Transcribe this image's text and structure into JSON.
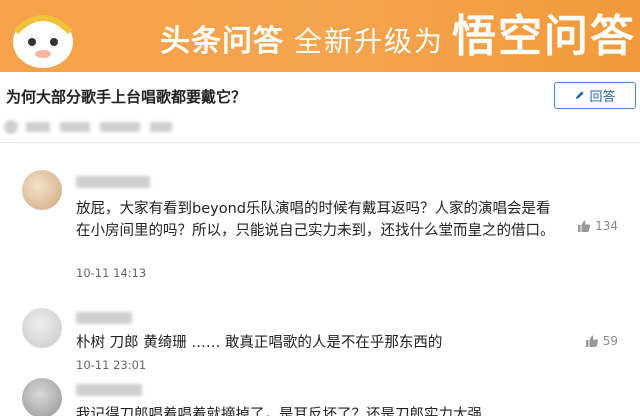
{
  "banner": {
    "brand": "头条问答",
    "slogan": "全新升级为",
    "new_brand": "悟空问答"
  },
  "question": {
    "title": "为何大部分歌手上台唱歌都要戴它？",
    "answer_button_label": "回答"
  },
  "answers": [
    {
      "text": "放屁，大家有看到beyond乐队演唱的时候有戴耳返吗？人家的演唱会是看在小房间里的吗？所以，只能说自己实力未到，还找什么堂而皇之的借口。",
      "time": "10-11 14:13",
      "likes": "134"
    },
    {
      "text": "朴树 刀郎 黄绮珊 …… 敢真正唱歌的人是不在乎那东西的",
      "time": "10-11 23:01",
      "likes": "59"
    },
    {
      "text": "我记得刀郎唱着唱着就摘掉了，是耳反坏了？还是刀郎实力太强"
    }
  ],
  "icons": {
    "edit": "pencil-icon",
    "like": "thumbs-up-icon"
  },
  "colors": {
    "banner": "#f4a54f",
    "button_border": "#4a86c9",
    "button_text": "#2a64a8"
  }
}
